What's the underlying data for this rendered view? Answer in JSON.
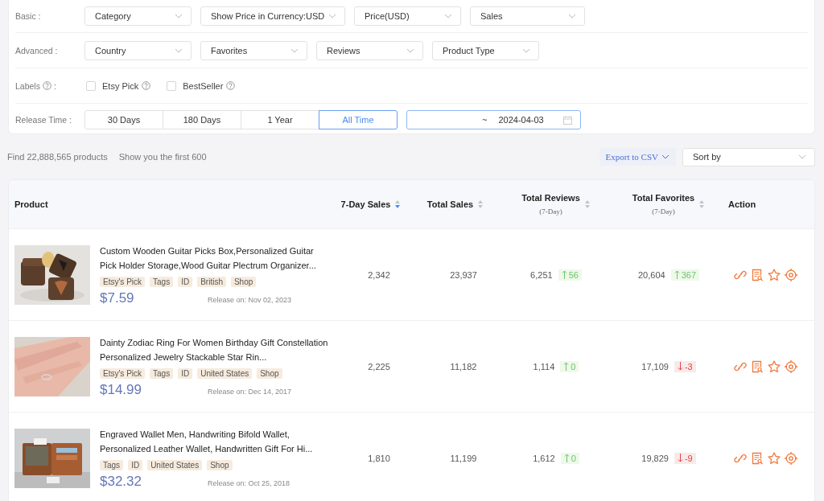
{
  "filters": {
    "basic": {
      "label": "Basic :",
      "dropdowns": [
        {
          "text": "Category"
        },
        {
          "text": "Show Price in Currency:USD"
        },
        {
          "text": "Price(USD)"
        },
        {
          "text": "Sales"
        }
      ]
    },
    "advanced": {
      "label": "Advanced :",
      "dropdowns": [
        {
          "text": "Country"
        },
        {
          "text": "Favorites"
        },
        {
          "text": "Reviews"
        },
        {
          "text": "Product Type"
        }
      ]
    },
    "labels": {
      "label": "Labels",
      "suffix": ":",
      "options": [
        {
          "text": "Etsy Pick",
          "checked": false
        },
        {
          "text": "BestSeller",
          "checked": false
        }
      ]
    },
    "release_time": {
      "label": "Release Time :",
      "options": [
        {
          "text": "30 Days",
          "selected": false
        },
        {
          "text": "180 Days",
          "selected": false
        },
        {
          "text": "1 Year",
          "selected": false
        },
        {
          "text": "All Time",
          "selected": true
        }
      ],
      "range": {
        "separator": "~",
        "end": "2024-04-03"
      }
    }
  },
  "summary": {
    "found": "Find 22,888,565 products",
    "shown": "Show you the first 600",
    "export": "Export to CSV",
    "sort": {
      "placeholder": "Sort by"
    }
  },
  "table": {
    "columns": [
      {
        "title": "Product",
        "sortable": false
      },
      {
        "title": "7-Day Sales",
        "sortable": true,
        "sorted": true
      },
      {
        "title": "Total Sales",
        "sortable": true,
        "sorted": false
      },
      {
        "title": "Total Reviews",
        "sub": "(7-Day)",
        "sortable": true,
        "sorted": false
      },
      {
        "title": "Total Favorites",
        "sub": "(7-Day)",
        "sortable": true,
        "sorted": false
      },
      {
        "title": "Action",
        "sortable": false
      }
    ],
    "rows": [
      {
        "image": {
          "kind": "picture"
        },
        "title": "Custom Wooden Guitar Picks Box,Personalized Guitar Pick Holder Storage,Wood Guitar Plectrum Organizer...",
        "tags": [
          "Etsy's Pick",
          "Tags",
          "ID",
          "British",
          "Shop"
        ],
        "price": "$7.59",
        "release": "Release on: Nov 02, 2023",
        "sales_7d": "2,342",
        "total_sales": "23,937",
        "reviews": {
          "value": "6,251",
          "delta": "56",
          "rising": true
        },
        "favorites": {
          "value": "20,604",
          "delta": "367",
          "rising": true
        }
      },
      {
        "image": {
          "kind": "picture"
        },
        "title": "Dainty Zodiac Ring For Women Birthday Gift Constellation Personalized Jewelry Stackable Star Rin...",
        "tags": [
          "Etsy's Pick",
          "Tags",
          "ID",
          "United States",
          "Shop"
        ],
        "price": "$14.99",
        "release": "Release on: Dec 14, 2017",
        "sales_7d": "2,225",
        "total_sales": "11,182",
        "reviews": {
          "value": "1,114",
          "delta": "0",
          "rising": true
        },
        "favorites": {
          "value": "17,109",
          "delta": "-3",
          "rising": false
        }
      },
      {
        "image": {
          "kind": "picture"
        },
        "title": "Engraved Wallet Men, Handwriting Bifold Wallet, Personalized Leather Wallet, Handwritten Gift For Hi...",
        "tags": [
          "Tags",
          "ID",
          "United States",
          "Shop"
        ],
        "price": "$32.32",
        "release": "Release on: Oct 25, 2018",
        "sales_7d": "1,810",
        "total_sales": "11,199",
        "reviews": {
          "value": "1,612",
          "delta": "0",
          "rising": true
        },
        "favorites": {
          "value": "19,829",
          "delta": "-9",
          "rising": false
        }
      }
    ]
  }
}
